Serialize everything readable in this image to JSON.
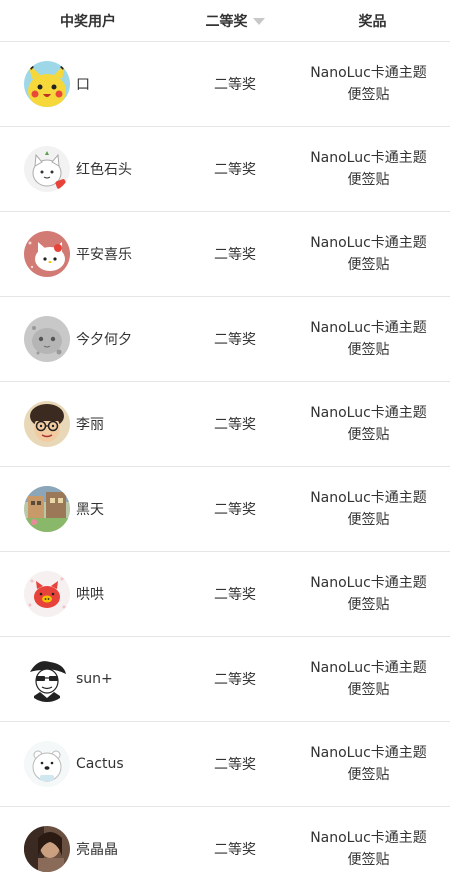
{
  "header": {
    "user_col": "中奖用户",
    "tier_col": "二等奖",
    "prize_col": "奖品"
  },
  "rows": [
    {
      "user": "口",
      "tier": "二等奖",
      "prize_line1": "NanoLuc卡通主题",
      "prize_line2": "便签贴",
      "avatar": "pikachu-avatar"
    },
    {
      "user": "红色石头",
      "tier": "二等奖",
      "prize_line1": "NanoLuc卡通主题",
      "prize_line2": "便签贴",
      "avatar": "white-cat-avatar"
    },
    {
      "user": "平安喜乐",
      "tier": "二等奖",
      "prize_line1": "NanoLuc卡通主题",
      "prize_line2": "便签贴",
      "avatar": "hello-kitty-avatar"
    },
    {
      "user": "今夕何夕",
      "tier": "二等奖",
      "prize_line1": "NanoLuc卡通主题",
      "prize_line2": "便签贴",
      "avatar": "gray-cat-avatar"
    },
    {
      "user": "李丽",
      "tier": "二等奖",
      "prize_line1": "NanoLuc卡通主题",
      "prize_line2": "便签贴",
      "avatar": "glasses-girl-avatar"
    },
    {
      "user": "黑天",
      "tier": "二等奖",
      "prize_line1": "NanoLuc卡通主题",
      "prize_line2": "便签贴",
      "avatar": "street-scene-avatar"
    },
    {
      "user": "哄哄",
      "tier": "二等奖",
      "prize_line1": "NanoLuc卡通主题",
      "prize_line2": "便签贴",
      "avatar": "red-pig-avatar"
    },
    {
      "user": "sun+",
      "tier": "二等奖",
      "prize_line1": "NanoLuc卡通主题",
      "prize_line2": "便签贴",
      "avatar": "sketch-man-avatar"
    },
    {
      "user": "Cactus",
      "tier": "二等奖",
      "prize_line1": "NanoLuc卡通主题",
      "prize_line2": "便签贴",
      "avatar": "polar-bear-avatar"
    },
    {
      "user": "亮晶晶",
      "tier": "二等奖",
      "prize_line1": "NanoLuc卡通主题",
      "prize_line2": "便签贴",
      "avatar": "portrait-avatar"
    }
  ],
  "colors": {
    "divider": "#e6e6e6",
    "text": "#333333",
    "sort_arrow": "#c8c8c8"
  }
}
